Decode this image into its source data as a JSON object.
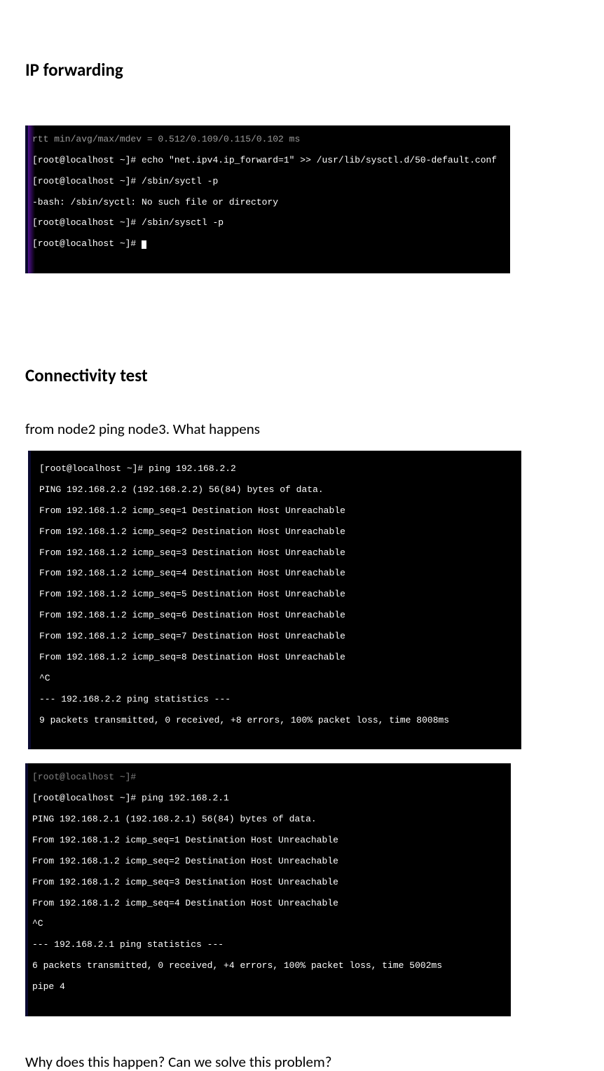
{
  "headings": {
    "h1": "IP forwarding",
    "h2": "Connectivity test"
  },
  "paragraphs": {
    "p1": "from node2 ping node3. What happens",
    "p2": "Why does this happen? Can we solve this problem?"
  },
  "terminal1": {
    "top_cut": "rtt min/avg/max/mdev = 0.512/0.109/0.115/0.102 ms",
    "l1": "[root@localhost ~]# echo \"net.ipv4.ip_forward=1\" >> /usr/lib/sysctl.d/50-default.conf",
    "l2": "[root@localhost ~]# /sbin/syctl -p",
    "l3": "-bash: /sbin/syctl: No such file or directory",
    "l4": "[root@localhost ~]# /sbin/sysctl -p",
    "l5": "[root@localhost ~]# "
  },
  "terminal2": {
    "l0": "[root@localhost ~]# ping 192.168.2.2",
    "l1": "PING 192.168.2.2 (192.168.2.2) 56(84) bytes of data.",
    "l2": "From 192.168.1.2 icmp_seq=1 Destination Host Unreachable",
    "l3": "From 192.168.1.2 icmp_seq=2 Destination Host Unreachable",
    "l4": "From 192.168.1.2 icmp_seq=3 Destination Host Unreachable",
    "l5": "From 192.168.1.2 icmp_seq=4 Destination Host Unreachable",
    "l6": "From 192.168.1.2 icmp_seq=5 Destination Host Unreachable",
    "l7": "From 192.168.1.2 icmp_seq=6 Destination Host Unreachable",
    "l8": "From 192.168.1.2 icmp_seq=7 Destination Host Unreachable",
    "l9": "From 192.168.1.2 icmp_seq=8 Destination Host Unreachable",
    "l10": "^C",
    "l11": "--- 192.168.2.2 ping statistics ---",
    "l12": "9 packets transmitted, 0 received, +8 errors, 100% packet loss, time 8008ms"
  },
  "terminal3": {
    "top_cut": "[root@localhost ~]#",
    "l0": "[root@localhost ~]# ping 192.168.2.1",
    "l1": "PING 192.168.2.1 (192.168.2.1) 56(84) bytes of data.",
    "l2": "From 192.168.1.2 icmp_seq=1 Destination Host Unreachable",
    "l3": "From 192.168.1.2 icmp_seq=2 Destination Host Unreachable",
    "l4": "From 192.168.1.2 icmp_seq=3 Destination Host Unreachable",
    "l5": "From 192.168.1.2 icmp_seq=4 Destination Host Unreachable",
    "l6": "^C",
    "l7": "--- 192.168.2.1 ping statistics ---",
    "l8": "6 packets transmitted, 0 received, +4 errors, 100% packet loss, time 5002ms",
    "l9": "pipe 4"
  }
}
